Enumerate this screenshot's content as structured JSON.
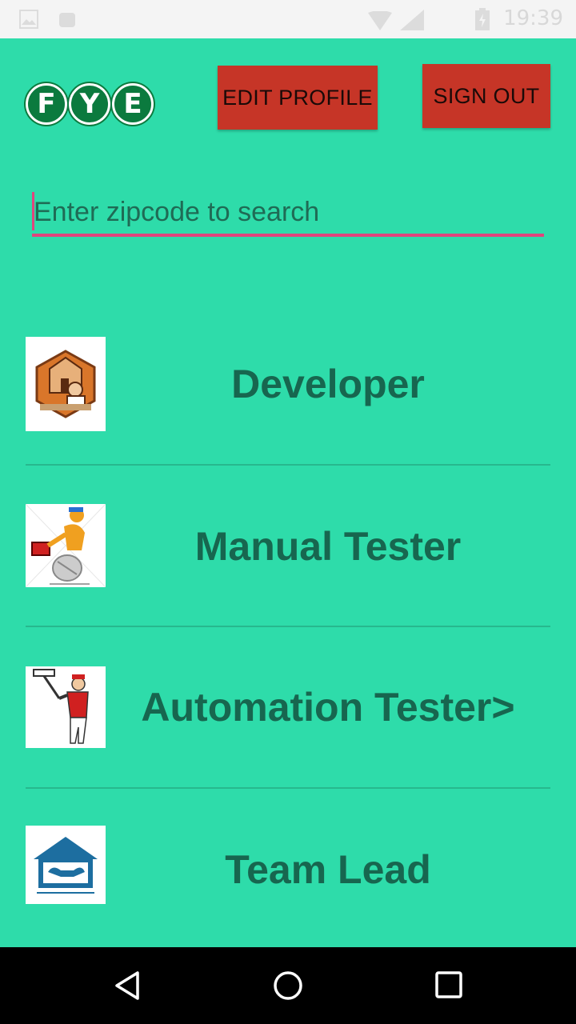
{
  "status_bar": {
    "time": "19:39",
    "icons": [
      "image-icon",
      "android-icon",
      "wifi-icon",
      "signal-icon",
      "battery-icon"
    ]
  },
  "header": {
    "logo_letters": [
      "F",
      "Y",
      "E"
    ],
    "edit_profile_label": "EDIT PROFILE",
    "sign_out_label": "SIGN OUT"
  },
  "search": {
    "placeholder": "Enter zipcode to search",
    "value": ""
  },
  "list": {
    "items": [
      {
        "label": "Developer",
        "icon": "house-worker-icon"
      },
      {
        "label": "Manual Tester",
        "icon": "toolbox-worker-icon"
      },
      {
        "label": "Automation Tester>",
        "icon": "painter-icon"
      },
      {
        "label": "Team Lead",
        "icon": "home-tools-icon"
      }
    ]
  },
  "nav_bar": {
    "icons": [
      "back-icon",
      "home-icon",
      "recents-icon"
    ]
  },
  "colors": {
    "background": "#2edcaa",
    "button": "#c63527",
    "accent": "#e0457d",
    "label_text": "#17664f",
    "logo": "#0b7a3e"
  }
}
